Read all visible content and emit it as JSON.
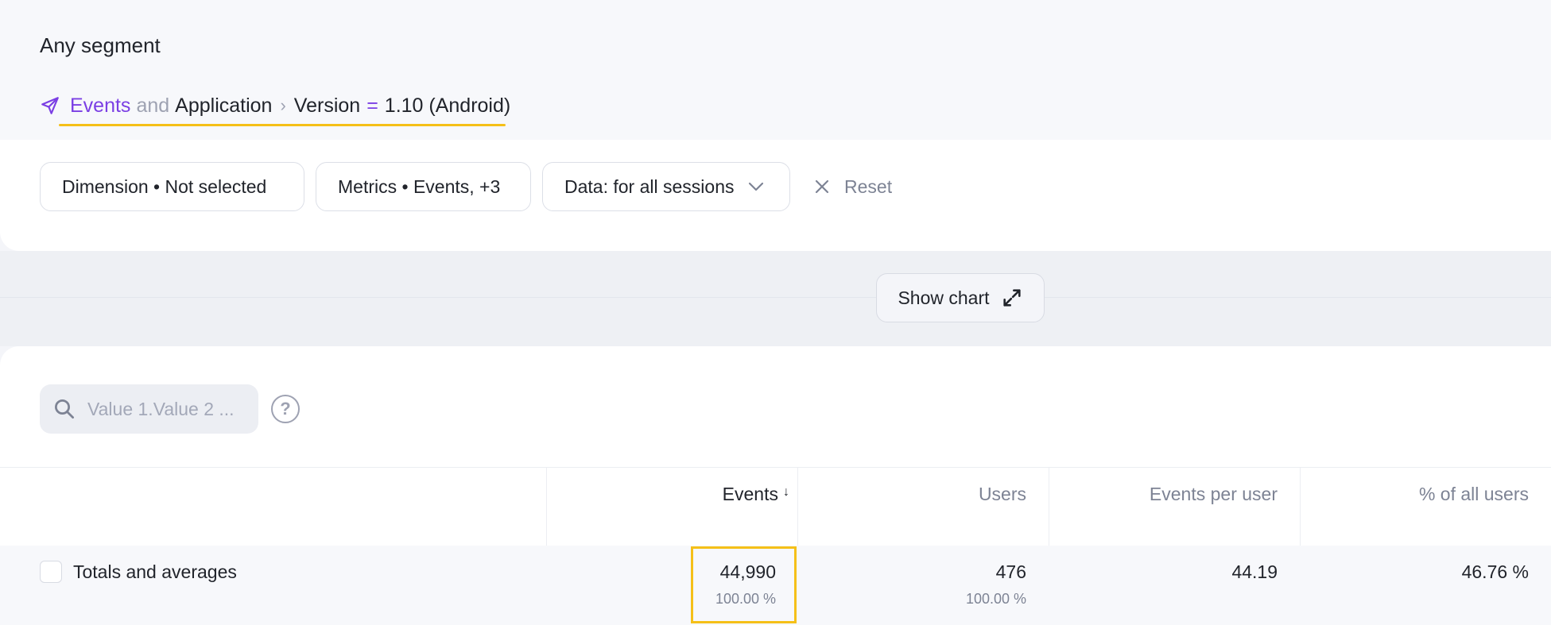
{
  "segment": {
    "title": "Any segment",
    "breadcrumb": {
      "events": "Events",
      "and": "and",
      "application": "Application",
      "separator": "›",
      "version_label": "Version",
      "equals": "=",
      "version_value": "1.10 (Android)"
    }
  },
  "filters": {
    "dimension": "Dimension • Not selected",
    "metrics": "Metrics • Events, +3",
    "data": "Data: for all sessions",
    "reset": "Reset"
  },
  "chart_toggle": {
    "label": "Show chart"
  },
  "search": {
    "placeholder": "Value 1.Value 2 ..."
  },
  "help": {
    "symbol": "?"
  },
  "table": {
    "columns": {
      "events": "Events",
      "users": "Users",
      "events_per_user": "Events per user",
      "pct_all_users": "% of all users"
    },
    "sort_indicator": "↓",
    "totals_row": {
      "label": "Totals and averages",
      "events": "44,990",
      "events_pct": "100.00 %",
      "users": "476",
      "users_pct": "100.00 %",
      "events_per_user": "44.19",
      "pct_all_users": "46.76 %"
    }
  },
  "colors": {
    "accent": "#7b3fe4",
    "highlight": "#f5c018"
  }
}
